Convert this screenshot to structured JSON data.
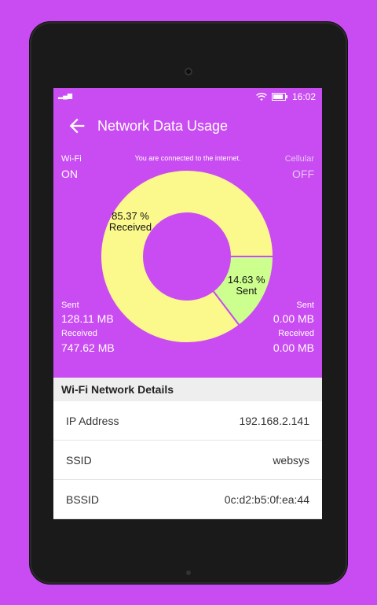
{
  "status": {
    "signal": "▂▄▆",
    "time": "16:02"
  },
  "toolbar": {
    "title": "Network Data Usage"
  },
  "connection": {
    "message": "You are connected to the internet.",
    "wifi_label": "Wi-Fi",
    "wifi_state": "ON",
    "cellular_label": "Cellular",
    "cellular_state": "OFF"
  },
  "wifi_stats": {
    "sent_label": "Sent",
    "sent_value": "128.11 MB",
    "received_label": "Received",
    "received_value": "747.62 MB"
  },
  "cellular_stats": {
    "sent_label": "Sent",
    "sent_value": "0.00 MB",
    "received_label": "Received",
    "received_value": "0.00 MB"
  },
  "chart_data": {
    "type": "pie",
    "categories": [
      "Received",
      "Sent"
    ],
    "values": [
      85.37,
      14.63
    ],
    "labels": [
      "85.37 %\nReceived",
      "14.63 %\nSent"
    ],
    "colors": [
      "#fbf98c",
      "#ccff8e"
    ]
  },
  "details": {
    "header": "Wi-Fi Network Details",
    "rows": [
      {
        "label": "IP Address",
        "value": "192.168.2.141"
      },
      {
        "label": "SSID",
        "value": "websys"
      },
      {
        "label": "BSSID",
        "value": "0c:d2:b5:0f:ea:44"
      }
    ]
  },
  "icons": [
    "back-arrow-icon",
    "wifi-icon",
    "battery-icon",
    "signal-icon"
  ]
}
